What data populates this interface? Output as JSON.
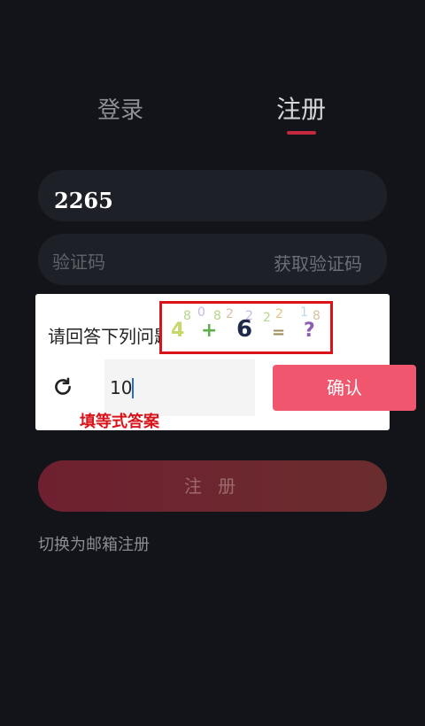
{
  "tabs": {
    "login": "登录",
    "register": "注册"
  },
  "form": {
    "phone_value": "2265",
    "code_placeholder": "验证码",
    "get_code": "获取验证码"
  },
  "captcha_dialog": {
    "question": "请回答下列问题",
    "captcha_symbols": [
      "4",
      "+",
      "6",
      "=",
      "?"
    ],
    "answer_value": "10",
    "confirm_label": "确认"
  },
  "annotation": "填等式答案",
  "register_button": "注 册",
  "switch_to_email": "切换为邮箱注册",
  "colors": {
    "accent": "#c4283f",
    "confirm": "#f0566e",
    "annotation": "#d8141a",
    "background": "#121419"
  }
}
